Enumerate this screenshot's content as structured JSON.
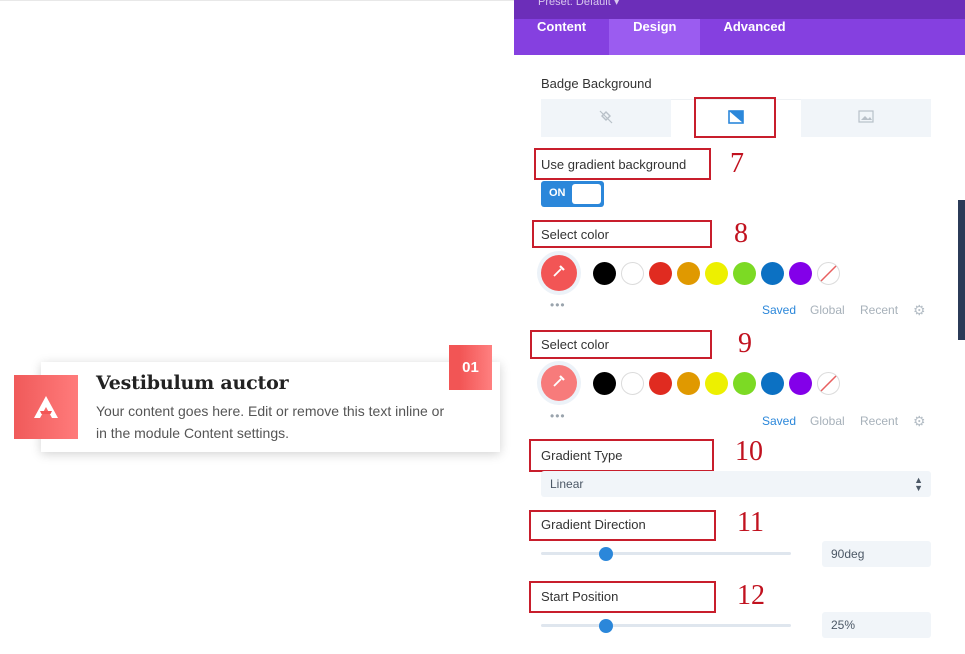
{
  "preview": {
    "card_title": "Vestibulum auctor",
    "card_text": "Your content goes here. Edit or remove this text inline or in the module Content settings.",
    "badge_number": "01",
    "icon": "logo-triangle-icon"
  },
  "panel": {
    "preset_label": "Preset: Default ▾",
    "tabs": [
      {
        "label": "Content",
        "active": false
      },
      {
        "label": "Design",
        "active": true
      },
      {
        "label": "Advanced",
        "active": false
      }
    ],
    "badge_background_label": "Badge Background",
    "background_tabs": [
      "paint-bucket-icon",
      "gradient-icon",
      "image-icon"
    ],
    "use_gradient_label": "Use gradient background",
    "toggle_state": "ON",
    "color_pickers": [
      {
        "label": "Select color",
        "picker_color": "#f25555"
      },
      {
        "label": "Select color",
        "picker_color": "#f77b7b"
      }
    ],
    "swatches": [
      "#000000",
      "#ffffff",
      "#e02b20",
      "#e09900",
      "#edf000",
      "#7cda24",
      "#0c71c3",
      "#8300e9"
    ],
    "palette_tabs": {
      "saved": "Saved",
      "global": "Global",
      "recent": "Recent"
    },
    "gradient_type_label": "Gradient Type",
    "gradient_type_value": "Linear",
    "gradient_direction_label": "Gradient Direction",
    "gradient_direction_value": "90deg",
    "start_position_label": "Start Position",
    "start_position_value": "25%"
  },
  "annotations": [
    "7",
    "8",
    "9",
    "10",
    "11",
    "12"
  ],
  "colors": {
    "accent_purple": "#8540e0",
    "accent_blue": "#2b87da",
    "annotation_red": "#c81e2c",
    "brand_red": "#f25555"
  }
}
